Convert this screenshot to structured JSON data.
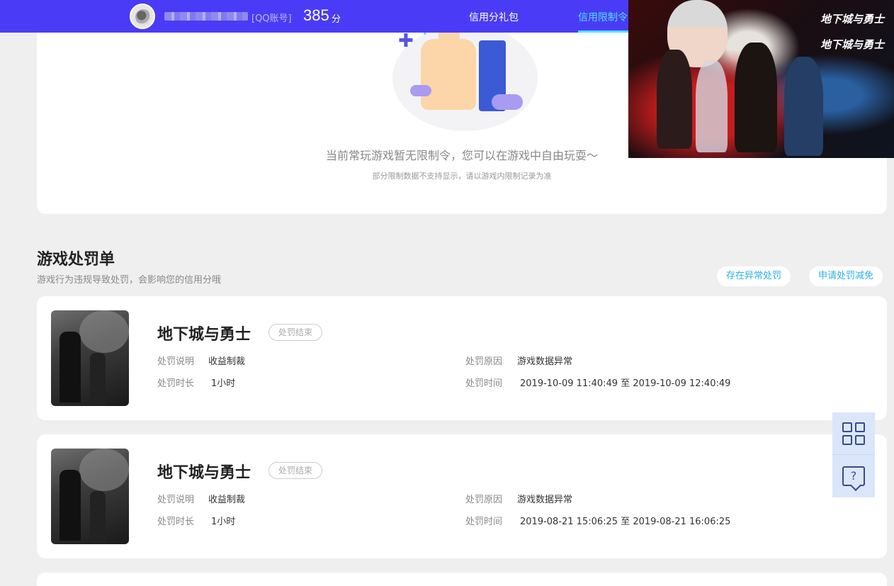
{
  "header": {
    "account_tag": "[QQ账号]",
    "score": "385",
    "score_unit": "分",
    "nav": [
      "信用分礼包",
      "信用限制令"
    ]
  },
  "banner": {
    "logo": "地下城与勇士",
    "logo2": "地下城与勇士"
  },
  "limit_card": {
    "title": "当前常玩游戏暂无限制令，您可以在游戏中自由玩耍～",
    "subtitle": "部分限制数据不支持显示，请以游戏内限制记录为准"
  },
  "penalty_section": {
    "title": "游戏处罚单",
    "subtitle": "游戏行为违规导致处罚，会影响您的信用分哦",
    "btn_abnormal": "存在异常处罚",
    "btn_reduce": "申请处罚减免"
  },
  "labels": {
    "desc": "处罚说明",
    "reason": "处罚原因",
    "duration": "处罚时长",
    "time": "处罚时间"
  },
  "penalties": [
    {
      "game": "地下城与勇士",
      "status": "处罚结束",
      "desc": "收益制裁",
      "reason": "游戏数据异常",
      "duration": "1小时",
      "time": "2019-10-09 11:40:49 至 2019-10-09 12:40:49"
    },
    {
      "game": "地下城与勇士",
      "status": "处罚结束",
      "desc": "收益制裁",
      "reason": "游戏数据异常",
      "duration": "1小时",
      "time": "2019-08-21 15:06:25 至 2019-08-21 16:06:25"
    }
  ],
  "side_tools": {
    "qr_icon": "qr-code-icon",
    "help_icon": "help-chat-icon"
  }
}
